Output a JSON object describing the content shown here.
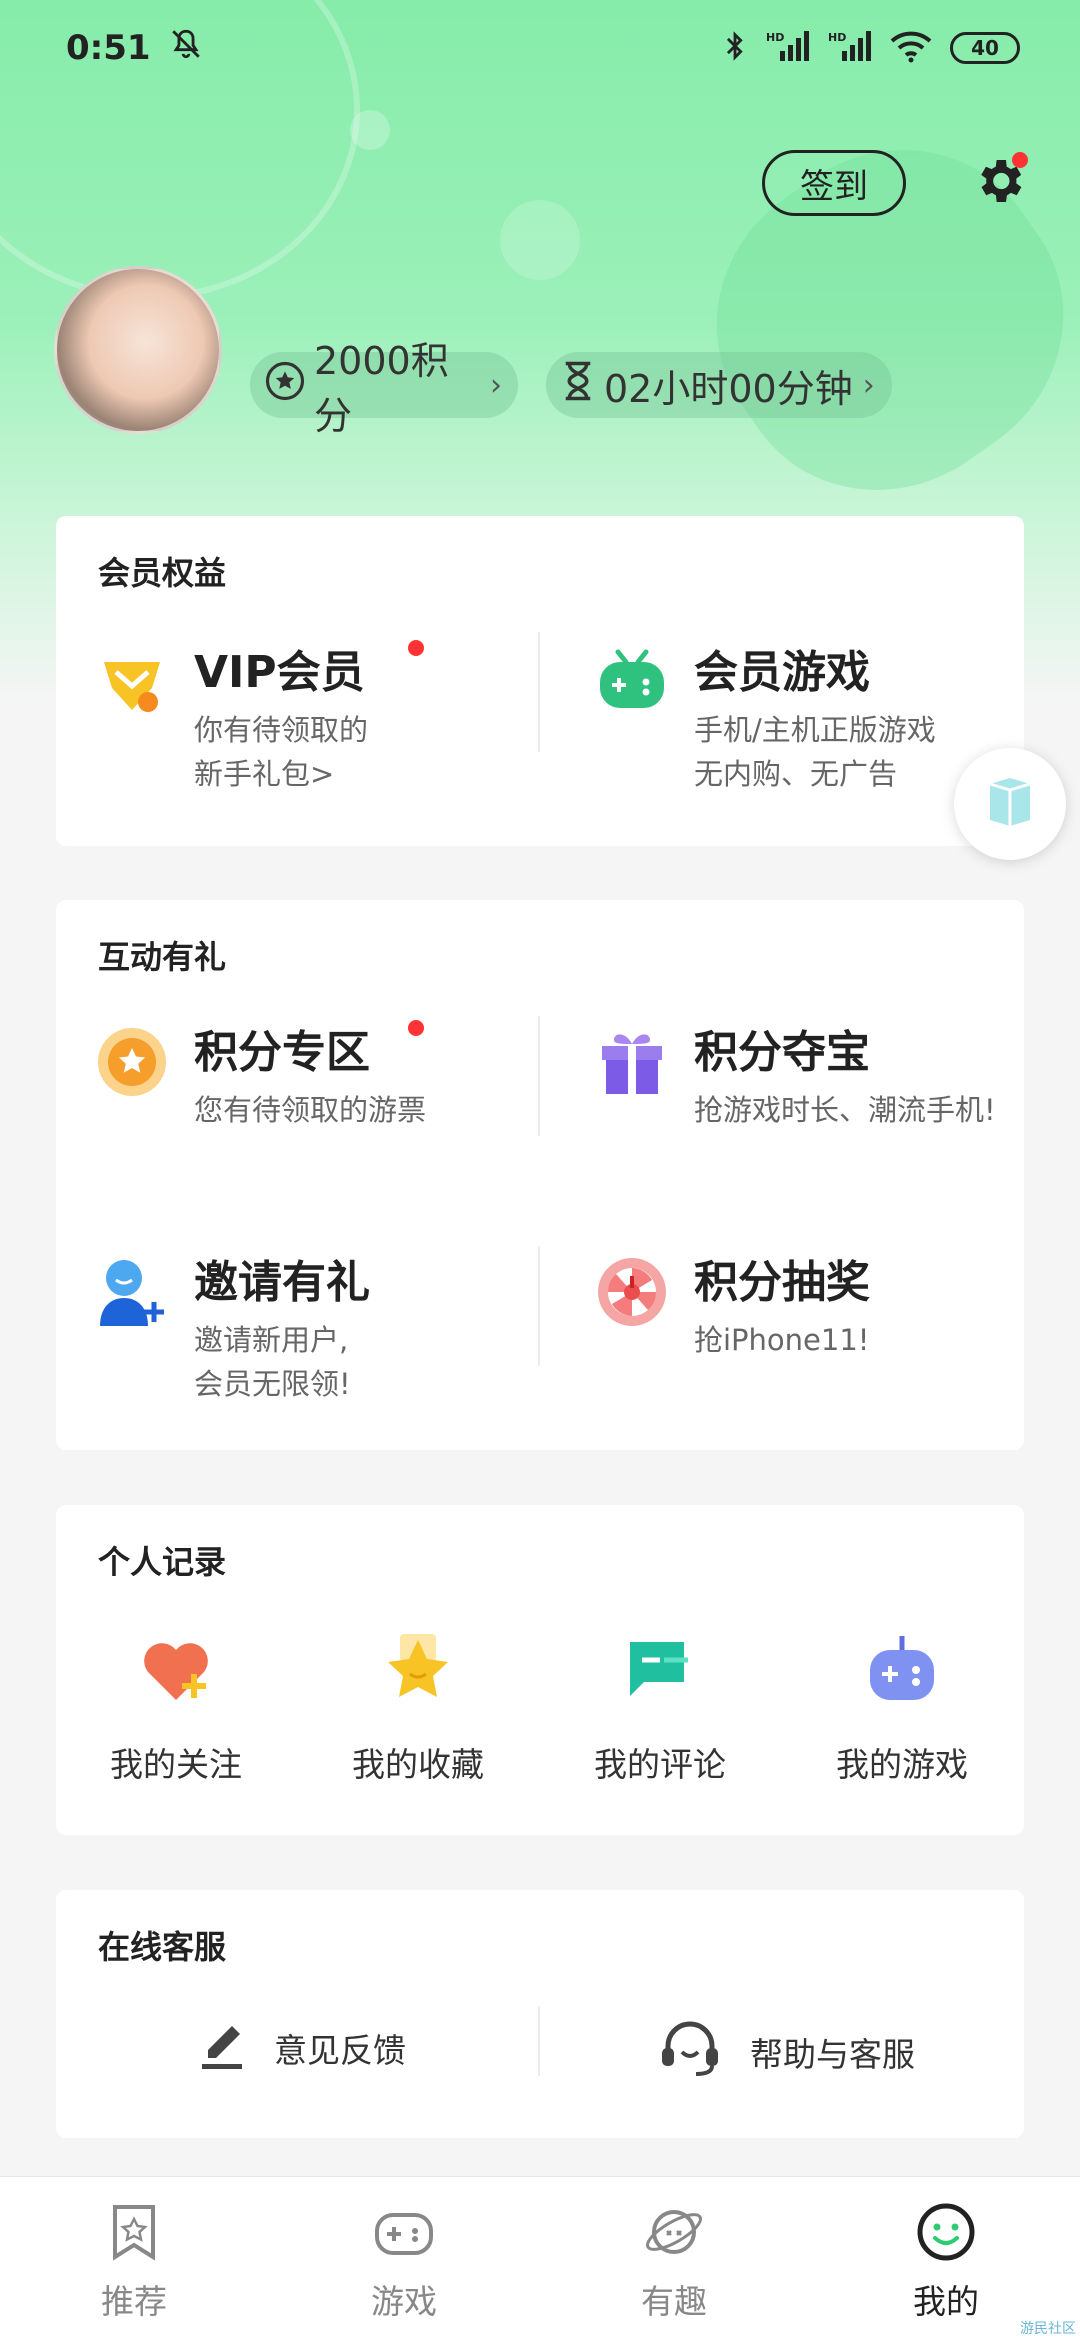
{
  "status_bar": {
    "time": "0:51",
    "battery": "40"
  },
  "header": {
    "signin_label": "签到",
    "points_label": "2000积分",
    "time_label": "02小时00分钟"
  },
  "member_card": {
    "title": "会员权益",
    "vip": {
      "name": "VIP会员",
      "desc_line1": "你有待领取的",
      "desc_line2": "新手礼包>"
    },
    "games": {
      "name": "会员游戏",
      "desc_line1": "手机/主机正版游戏",
      "desc_line2": "无内购、无广告"
    }
  },
  "interact_card": {
    "title": "互动有礼",
    "points_zone": {
      "name": "积分专区",
      "desc_line1": "您有待领取的游票"
    },
    "treasure": {
      "name": "积分夺宝",
      "desc_line1": "抢游戏时长、潮流手机!"
    },
    "invite": {
      "name": "邀请有礼",
      "desc_line1": "邀请新用户,",
      "desc_line2": "会员无限领!"
    },
    "lottery": {
      "name": "积分抽奖",
      "desc_line1": "抢iPhone11!"
    }
  },
  "records_card": {
    "title": "个人记录",
    "items": [
      {
        "label": "我的关注"
      },
      {
        "label": "我的收藏"
      },
      {
        "label": "我的评论"
      },
      {
        "label": "我的游戏"
      }
    ]
  },
  "service_card": {
    "title": "在线客服",
    "feedback_label": "意见反馈",
    "help_label": "帮助与客服"
  },
  "tabbar": {
    "tabs": [
      {
        "label": "推荐"
      },
      {
        "label": "游戏"
      },
      {
        "label": "有趣"
      },
      {
        "label": "我的"
      }
    ],
    "active_index": 3
  },
  "watermark": "游民社区",
  "colors": {
    "accent_green": "#2ecc71",
    "badge_red": "#ff3333",
    "hero_green": "#86ecaa"
  }
}
